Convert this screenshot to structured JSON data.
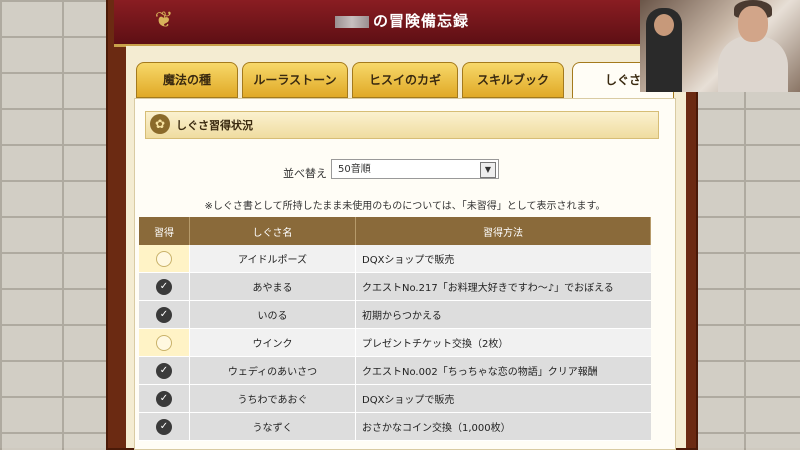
{
  "header": {
    "title_suffix": "の冒険備忘録"
  },
  "tabs": [
    {
      "label": "魔法の種",
      "active": false
    },
    {
      "label": "ルーラストーン",
      "active": false
    },
    {
      "label": "ヒスイのカギ",
      "active": false
    },
    {
      "label": "スキルブック",
      "active": false
    },
    {
      "label": "しぐさ",
      "active": true
    }
  ],
  "section": {
    "title": "しぐさ習得状況"
  },
  "sort": {
    "label": "並べ替え",
    "selected": "50音順"
  },
  "note": "※しぐさ書として所持したまま未使用のものについては、「未習得」として表示されます。",
  "table": {
    "headers": {
      "status": "習得",
      "name": "しぐさ名",
      "method": "習得方法"
    },
    "rows": [
      {
        "learned": false,
        "name": "アイドルポーズ",
        "method": "DQXショップで販売"
      },
      {
        "learned": true,
        "name": "あやまる",
        "method": "クエストNo.217「お料理大好きですわ～♪」でおぼえる"
      },
      {
        "learned": true,
        "name": "いのる",
        "method": "初期からつかえる"
      },
      {
        "learned": false,
        "name": "ウインク",
        "method": "プレゼントチケット交換（2枚）"
      },
      {
        "learned": true,
        "name": "ウェディのあいさつ",
        "method": "クエストNo.002「ちっちゃな恋の物語」クリア報酬"
      },
      {
        "learned": true,
        "name": "うちわであおぐ",
        "method": "DQXショップで販売"
      },
      {
        "learned": true,
        "name": "うなずく",
        "method": "おさかなコイン交換（1,000枚）"
      }
    ]
  },
  "colors": {
    "accent": "#8a1d22",
    "tab": "#e0a926",
    "header_row": "#8a6a3a"
  }
}
